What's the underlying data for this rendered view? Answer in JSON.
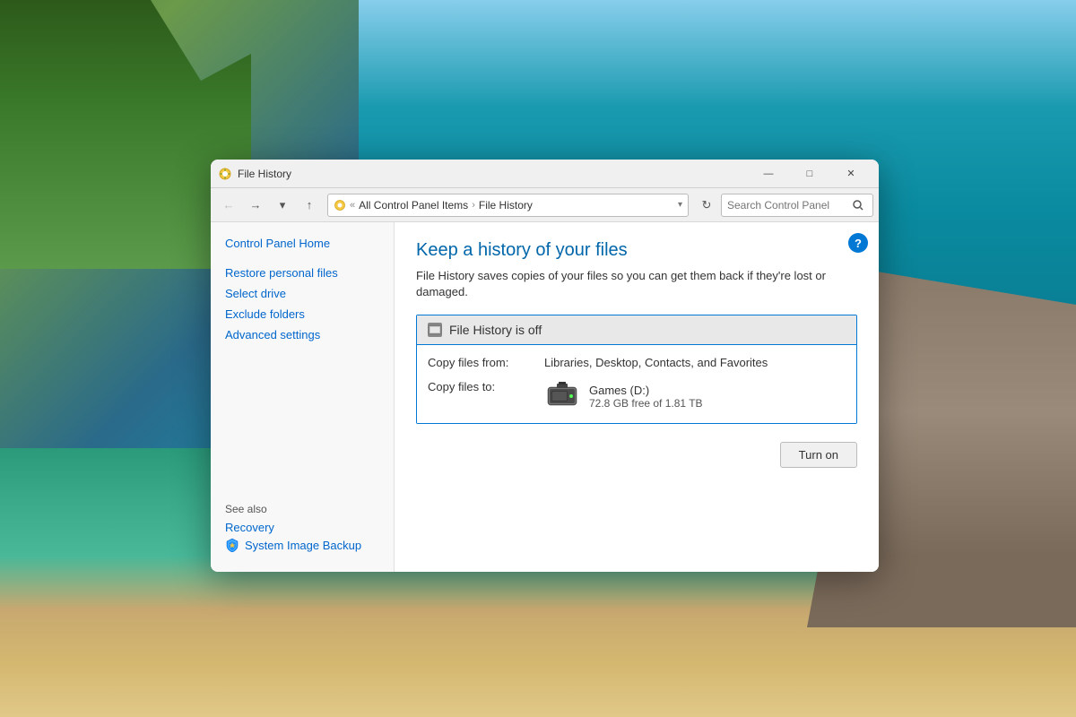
{
  "desktop": {
    "background_desc": "Coastal landscape with trees, ocean, and beach"
  },
  "window": {
    "title": "File History",
    "icon_desc": "control-panel-icon",
    "title_buttons": {
      "minimize": "—",
      "maximize": "□",
      "close": "✕"
    }
  },
  "toolbar": {
    "back_btn": "←",
    "forward_btn": "→",
    "dropdown_btn": "▾",
    "up_btn": "↑",
    "address": {
      "icon_desc": "control-panel-address-icon",
      "prefix": "«",
      "path_part1": "All Control Panel Items",
      "separator": "›",
      "path_part2": "File History"
    },
    "refresh_btn": "↻",
    "search_placeholder": "Search Control Panel"
  },
  "sidebar": {
    "items": [
      {
        "label": "Control Panel Home",
        "type": "link"
      },
      {
        "label": "Restore personal files",
        "type": "link"
      },
      {
        "label": "Select drive",
        "type": "link"
      },
      {
        "label": "Exclude folders",
        "type": "link"
      },
      {
        "label": "Advanced settings",
        "type": "link"
      }
    ],
    "see_also_label": "See also",
    "see_also_items": [
      {
        "label": "Recovery",
        "type": "plain"
      },
      {
        "label": "System Image Backup",
        "type": "shield"
      }
    ]
  },
  "main": {
    "title": "Keep a history of your files",
    "description": "File History saves copies of your files so you can get them back if they're lost or damaged.",
    "file_history_box": {
      "status": "File History is off",
      "copy_from_label": "Copy files from:",
      "copy_from_value": "Libraries, Desktop, Contacts, and Favorites",
      "copy_to_label": "Copy files to:",
      "drive_name": "Games (D:)",
      "drive_space": "72.8 GB free of 1.81 TB"
    },
    "turn_on_button": "Turn on",
    "help_button": "?"
  }
}
